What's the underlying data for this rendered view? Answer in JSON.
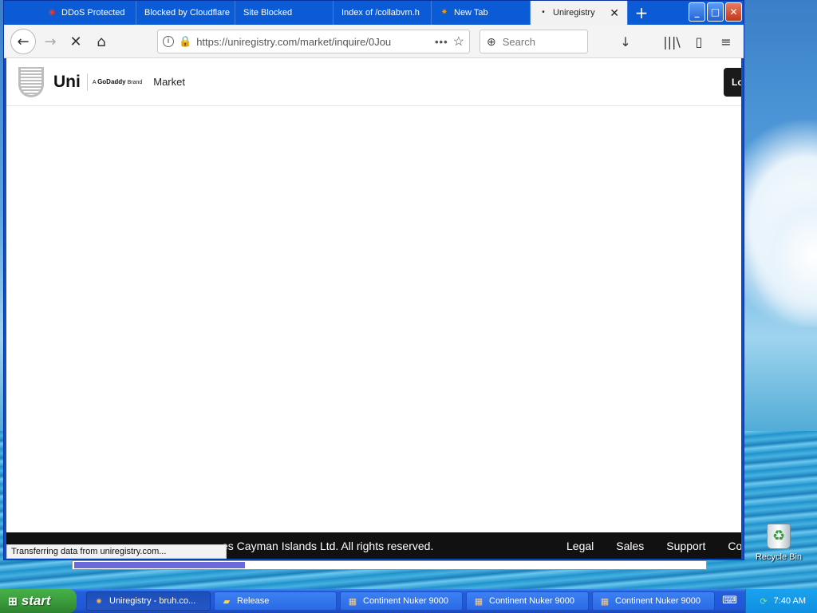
{
  "browser": {
    "tabs": [
      {
        "label": "DDoS Protected",
        "icon": "shield-favicon",
        "glyph": "◉"
      },
      {
        "label": "Blocked by Cloudflare",
        "icon": "",
        "glyph": ""
      },
      {
        "label": "Site Blocked",
        "icon": "",
        "glyph": ""
      },
      {
        "label": "Index of /collabvm.h",
        "icon": "",
        "glyph": ""
      },
      {
        "label": "New Tab",
        "icon": "firefox-favicon",
        "glyph": "✷"
      },
      {
        "label": "Uniregistry - ",
        "icon": "loading-dot",
        "glyph": "•"
      }
    ],
    "new_tab_glyph": "+",
    "tab_close_glyph": "✕",
    "window_buttons": {
      "minimize": "_",
      "maximize": "□",
      "close": "✕"
    },
    "url": "https://uniregistry.com/market/inquire/0Jou",
    "search_placeholder": "Search",
    "nav": {
      "back": "←",
      "forward": "→",
      "stop": "✕",
      "home": "⌂"
    },
    "url_info": "i",
    "url_lock": "🔒",
    "url_more": "•••",
    "url_star": "☆",
    "search_glass": "⊕",
    "toolbar": {
      "downloads": "↓",
      "library": "|||\\",
      "sidebar": "▯",
      "menu": "≡"
    },
    "status": "Transferring data from uniregistry.com..."
  },
  "site": {
    "brand": "Uni",
    "brand_sub_prefix": "A ",
    "brand_sub_name": "GoDaddy",
    "brand_sub_suffix": " Brand",
    "nav_market": "Market",
    "login_partial": "Lo",
    "footer_copy": "es Cayman Islands Ltd. All rights reserved.",
    "footer_links": [
      "Legal",
      "Sales",
      "Support",
      "Cor"
    ]
  },
  "progress": {
    "fraction": 0.27
  },
  "desktop": {
    "recycle_bin": "Recycle Bin"
  },
  "taskbar": {
    "start": "start",
    "start_flag": "⊞",
    "buttons": [
      {
        "label": "Uniregistry - bruh.co...",
        "icon": "firefox-icon",
        "glyph": "✷",
        "active": true
      },
      {
        "label": "Release",
        "icon": "folder-icon",
        "glyph": "▰",
        "active": false
      },
      {
        "label": "Continent Nuker 9000",
        "icon": "app-icon",
        "glyph": "▦",
        "active": false
      },
      {
        "label": "Continent Nuker 9000",
        "icon": "app-icon",
        "glyph": "▦",
        "active": false
      },
      {
        "label": "Continent Nuker 9000",
        "icon": "app-icon",
        "glyph": "▦",
        "active": false
      }
    ],
    "keyboard_glyph": "⌨",
    "tray_glyph": "⟳",
    "clock": "7:40 AM"
  },
  "colors": {
    "titlebar": "#0b5bd6",
    "taskbar": "#245edb",
    "start_green": "#3b9c3d",
    "footer": "#111111"
  }
}
